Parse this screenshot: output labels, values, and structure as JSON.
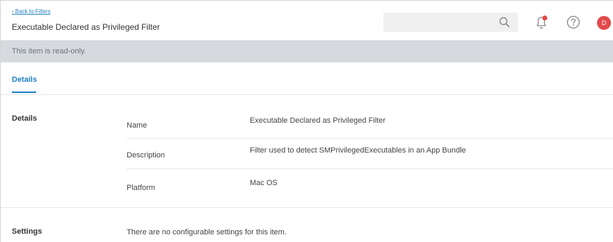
{
  "header": {
    "back_link": "‹ Back to Filters",
    "title": "Executable Declared as Privileged Filter",
    "search_placeholder": "",
    "avatar_initial": "D"
  },
  "readonly_notice": "This item is read-only.",
  "tabs": [
    {
      "label": "Details",
      "active": true
    }
  ],
  "details_section": {
    "heading": "Details",
    "fields": [
      {
        "label": "Name",
        "value": "Executable Declared as Privileged Filter"
      },
      {
        "label": "Description",
        "value": "Filter used to detect SMPrivilegedExecutables in an App Bundle"
      },
      {
        "label": "Platform",
        "value": "Mac OS"
      }
    ]
  },
  "settings_section": {
    "heading": "Settings",
    "message": "There are no configurable settings for this item."
  },
  "colors": {
    "accent": "#1f7fc2",
    "readonly_bar": "#d6dade",
    "avatar": "#e14a4a",
    "notification_dot": "#e14a4a"
  },
  "icons": [
    "search-icon",
    "bell-icon",
    "help-icon"
  ]
}
